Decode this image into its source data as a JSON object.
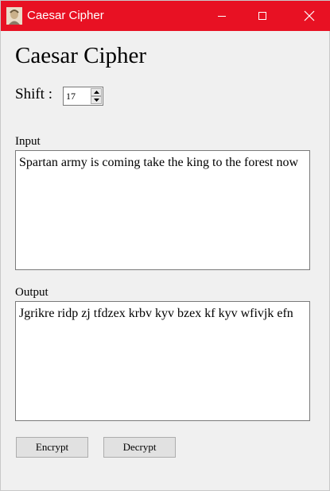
{
  "window": {
    "title": "Caesar Cipher",
    "titlebar_color": "#e81123",
    "icon": "caesar-bust-icon"
  },
  "main": {
    "heading": "Caesar Cipher",
    "shift": {
      "label": "Shift :",
      "value": "17"
    },
    "input": {
      "label": "Input",
      "text": "Spartan army is coming take the king to the forest now"
    },
    "output": {
      "label": "Output",
      "text": "Jgrikre ridp zj tfdzex krbv kyv bzex kf kyv wfivjk efn"
    },
    "buttons": {
      "encrypt": "Encrypt",
      "decrypt": "Decrypt"
    }
  }
}
